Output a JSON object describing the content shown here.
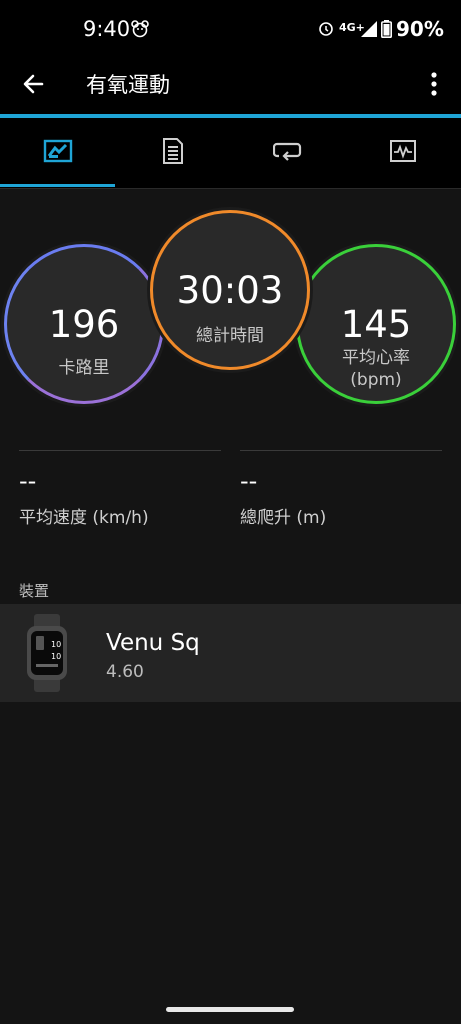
{
  "status_bar": {
    "time": "9:40",
    "network": "4G+",
    "battery": "90%"
  },
  "app_bar": {
    "title": "有氧運動"
  },
  "tabs": [
    {
      "name": "summary",
      "icon": "chart-icon",
      "selected": true
    },
    {
      "name": "details",
      "icon": "document-icon",
      "selected": false
    },
    {
      "name": "laps",
      "icon": "loop-icon",
      "selected": false
    },
    {
      "name": "graphs",
      "icon": "heart-graph-icon",
      "selected": false
    }
  ],
  "stats": {
    "calories": {
      "value": "196",
      "label": "卡路里"
    },
    "total_time": {
      "value": "30:03",
      "label": "總計時間"
    },
    "avg_hr": {
      "value": "145",
      "label": "平均心率",
      "unit": "(bpm)"
    }
  },
  "metrics": {
    "avg_speed": {
      "value": "--",
      "label": "平均速度 (km/h)"
    },
    "total_ascent": {
      "value": "--",
      "label": "總爬升 (m)"
    }
  },
  "device_section": {
    "title": "裝置"
  },
  "device": {
    "name": "Venu Sq",
    "version": "4.60",
    "screen_top": "10",
    "screen_bottom": "10"
  },
  "colors": {
    "accent": "#1fa5d6",
    "calories_ring": "#6a7cf0",
    "time_ring": "#f08a2a",
    "hr_ring": "#3ad03a"
  }
}
